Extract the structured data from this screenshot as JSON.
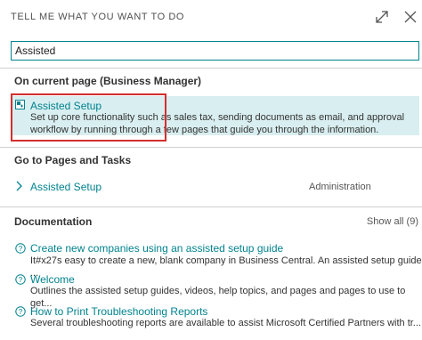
{
  "header": {
    "title": "TELL ME WHAT YOU WANT TO DO",
    "expand_icon": "expand-arrows-icon",
    "close_icon": "close-icon"
  },
  "search": {
    "value": "Assisted"
  },
  "current_page": {
    "title": "On current page (Business Manager)",
    "result": {
      "icon": "assisted-setup-icon",
      "title": "Assisted Setup",
      "description_line1": "Set up core functionality such as sales tax, sending documents as email, and approval",
      "description_line2": "workflow by running through a few pages that guide you through the information."
    }
  },
  "pages_tasks": {
    "title": "Go to Pages and Tasks",
    "result": {
      "title": "Assisted Setup",
      "category": "Administration"
    }
  },
  "documentation": {
    "title": "Documentation",
    "show_all": "Show all (9)",
    "items": [
      {
        "title": "Create new companies using an assisted setup guide",
        "description": "It#x27s easy to create a new, blank company in Business Central. An assisted setup guide ..."
      },
      {
        "title": "Welcome",
        "description": "Outlines the assisted setup guides, videos, help topics, and pages and pages to use to get..."
      },
      {
        "title": "How to Print Troubleshooting Reports",
        "description": "Several troubleshooting reports are available to assist Microsoft Certified Partners with tr..."
      }
    ]
  },
  "colors": {
    "accent": "#00838f",
    "highlight": "#d9eef0",
    "annotation": "#d32f2f"
  }
}
